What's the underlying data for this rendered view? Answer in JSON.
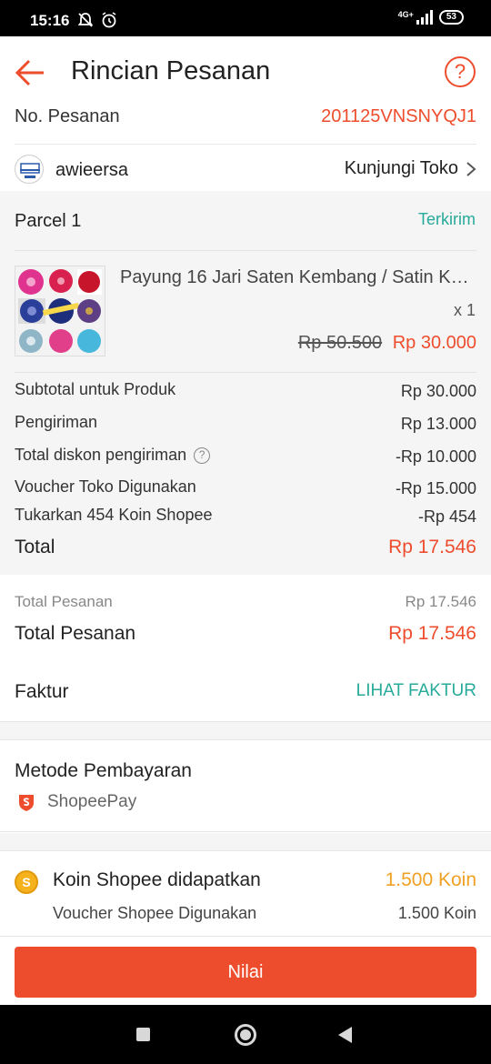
{
  "status_bar": {
    "time": "15:16",
    "network": "4G+",
    "battery": "53"
  },
  "header": {
    "title": "Rincian Pesanan",
    "help_glyph": "?"
  },
  "order": {
    "number_label": "No. Pesanan",
    "number_value": "201125VNSNYQJ1"
  },
  "shop": {
    "name": "awieersa",
    "visit_label": "Kunjungi Toko"
  },
  "parcel": {
    "title": "Parcel 1",
    "status": "Terkirim",
    "product": {
      "name": "Payung 16 Jari Saten Kembang / Satin Kembang",
      "quantity": "x 1",
      "price_original": "Rp 50.500",
      "price_final": "Rp 30.000"
    }
  },
  "summary": [
    {
      "label": "Subtotal untuk Produk",
      "value": "Rp 30.000"
    },
    {
      "label": "Pengiriman",
      "value": "Rp 13.000"
    },
    {
      "label": "Total diskon pengiriman",
      "value": "-Rp 10.000"
    },
    {
      "label": "Voucher Toko Digunakan",
      "value": "-Rp 15.000"
    },
    {
      "label": "Tukarkan 454 Koin Shopee",
      "value": "-Rp 454"
    }
  ],
  "total": {
    "label": "Total",
    "value": "Rp 17.546"
  },
  "order_total": {
    "small_label": "Total Pesanan",
    "small_value": "Rp 17.546",
    "label": "Total Pesanan",
    "value": "Rp 17.546"
  },
  "invoice": {
    "label": "Faktur",
    "link": "LIHAT FAKTUR"
  },
  "payment": {
    "title": "Metode Pembayaran",
    "method": "ShopeePay"
  },
  "coins": {
    "label": "Koin Shopee didapatkan",
    "value": "1.500 Koin",
    "voucher_label": "Voucher Shopee Digunakan",
    "voucher_value": "1.500 Koin"
  },
  "actions": {
    "rate_label": "Nilai"
  },
  "colors": {
    "brand": "#ee4d2d",
    "success": "#26aa99",
    "coin": "#f0a023"
  }
}
